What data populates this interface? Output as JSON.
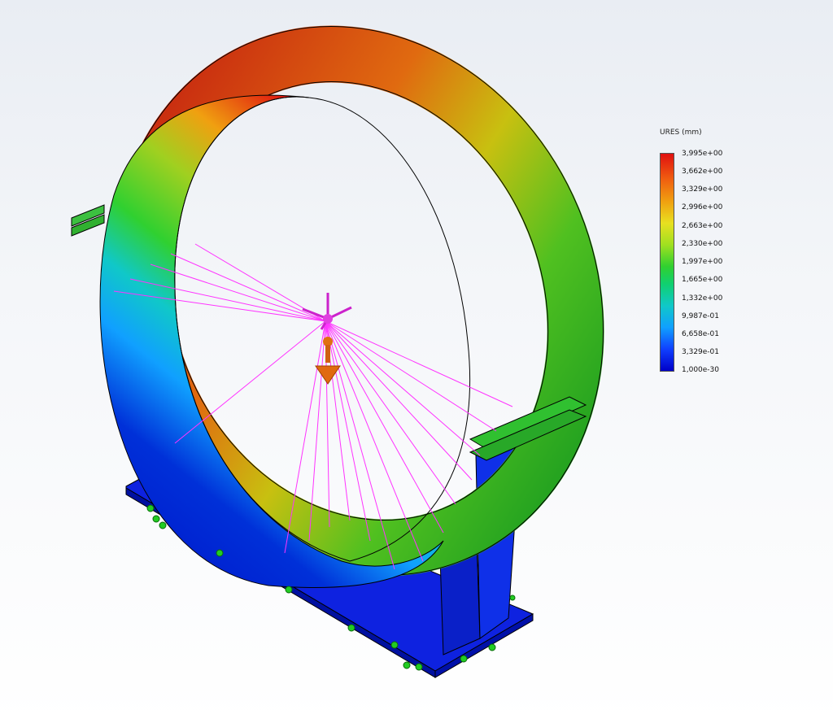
{
  "legend": {
    "title": "URES (mm)",
    "ticks": [
      "3,995e+00",
      "3,662e+00",
      "3,329e+00",
      "2,996e+00",
      "2,663e+00",
      "2,330e+00",
      "1,997e+00",
      "1,665e+00",
      "1,332e+00",
      "9,987e-01",
      "6,658e-01",
      "3,329e-01",
      "1,000e-30"
    ]
  },
  "colors": {
    "max": "#e01010",
    "mid": "#30d030",
    "min": "#0000c8",
    "load": "#ff33ff",
    "fixture": "#22cc22"
  },
  "icons": [
    "force-arrow-icon",
    "fixture-marker-icon",
    "remote-load-icon"
  ]
}
